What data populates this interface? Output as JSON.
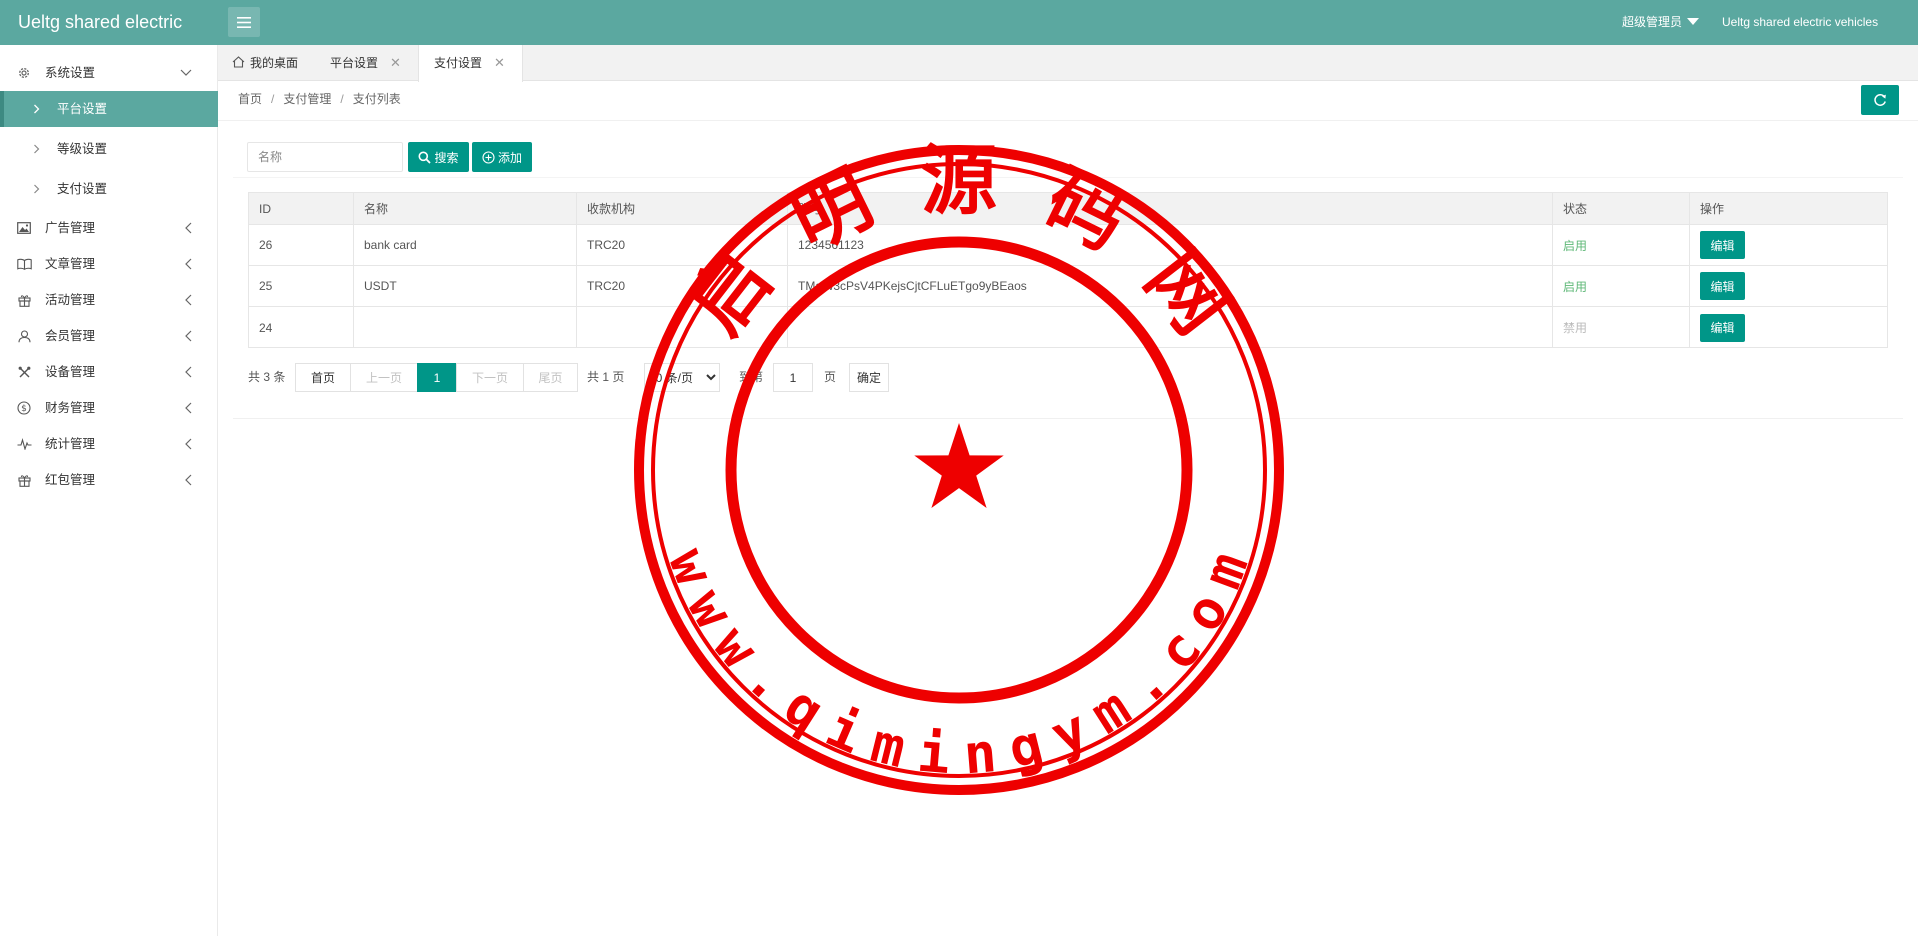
{
  "header": {
    "title": "Ueltg shared electric",
    "user": "超级管理员",
    "app_name": "Ueltg shared electric vehicles"
  },
  "sidebar": {
    "items": [
      {
        "label": "系统设置",
        "icon": "gear-icon",
        "expanded": true
      },
      {
        "label": "广告管理",
        "icon": "image-icon"
      },
      {
        "label": "文章管理",
        "icon": "book-icon"
      },
      {
        "label": "活动管理",
        "icon": "gift-icon"
      },
      {
        "label": "会员管理",
        "icon": "user-icon"
      },
      {
        "label": "设备管理",
        "icon": "tools-icon"
      },
      {
        "label": "财务管理",
        "icon": "dollar-icon"
      },
      {
        "label": "统计管理",
        "icon": "pulse-icon"
      },
      {
        "label": "红包管理",
        "icon": "gift-icon"
      }
    ],
    "sub_items": [
      {
        "label": "平台设置",
        "active": true
      },
      {
        "label": "等级设置"
      },
      {
        "label": "支付设置"
      }
    ]
  },
  "tabs": [
    {
      "label": "我的桌面",
      "icon": "home-icon"
    },
    {
      "label": "平台设置",
      "close": "✕"
    },
    {
      "label": "支付设置",
      "close": "✕",
      "active": true
    }
  ],
  "breadcrumb": {
    "items": [
      "首页",
      "支付管理",
      "支付列表"
    ],
    "separator": "/"
  },
  "toolbar": {
    "search_placeholder": "名称",
    "search_label": "搜索",
    "add_label": "添加"
  },
  "table": {
    "headers": [
      "ID",
      "名称",
      "收款机构",
      "账号",
      "状态",
      "操作"
    ],
    "rows": [
      {
        "id": "26",
        "name": "bank card",
        "org": "TRC20",
        "account": "1234561123",
        "status": "启用",
        "action": "编辑"
      },
      {
        "id": "25",
        "name": "USDT",
        "org": "TRC20",
        "account": "TMaiw3cPsV4PKejsCjtCFLuETgo9yBEaos",
        "status": "启用",
        "action": "编辑"
      },
      {
        "id": "24",
        "name": "",
        "org": "",
        "account": "",
        "status": "禁用",
        "action": "编辑"
      }
    ]
  },
  "pagination": {
    "total": "共 3 条",
    "first": "首页",
    "prev": "上一页",
    "current": "1",
    "next": "下一页",
    "last": "尾页",
    "pages": "共 1 页",
    "page_size": "10 条/页",
    "goto_prefix": "到第",
    "goto_value": "1",
    "goto_suffix": "页",
    "confirm": "确定"
  },
  "watermark": {
    "top_text": "启 明 源 码 网",
    "bottom_text": "www.qimingym.com",
    "color": "#ee0000"
  },
  "colors": {
    "header": "#5ba8a0",
    "primary": "#009688",
    "sidebar_active": "#5ba8a0",
    "status_on": "#5fb878",
    "status_off": "#bbbbbb"
  }
}
